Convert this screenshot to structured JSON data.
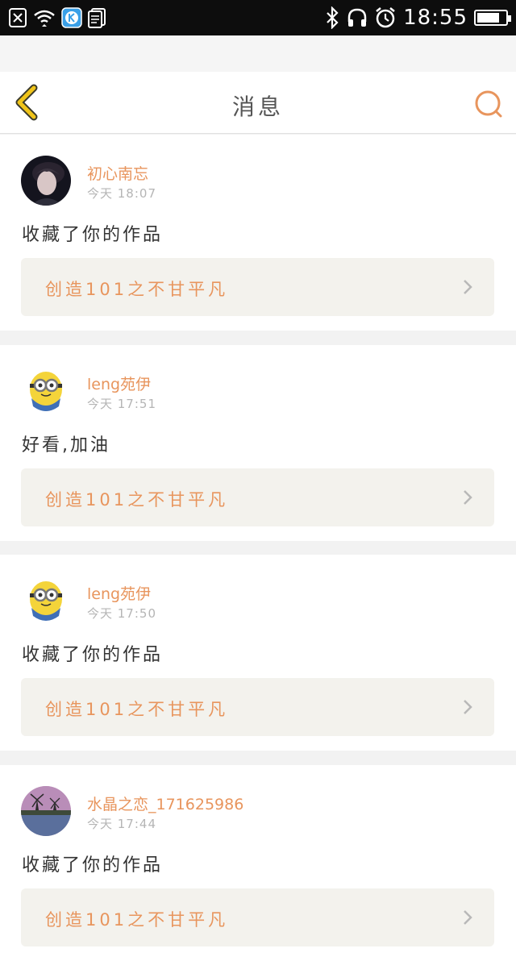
{
  "status_bar": {
    "time": "18:55",
    "battery_level": 0.8,
    "left_icons": [
      "sim-off-icon",
      "wifi-icon",
      "k-app-icon",
      "notes-icon"
    ],
    "right_icons": [
      "bluetooth-icon",
      "headphones-icon",
      "alarm-icon"
    ]
  },
  "header": {
    "title": "消息",
    "back_icon": "chevron-left-icon",
    "search_icon": "search-icon"
  },
  "colors": {
    "accent": "#e8955d",
    "back": "#f0c419",
    "link_bg": "#f3f2ed"
  },
  "messages": [
    {
      "username": "初心南忘",
      "time": "今天 18:07",
      "message": "收藏了你的作品",
      "work_title": "创造101之不甘平凡",
      "avatar": "portrait-avatar"
    },
    {
      "username": "leng苑伊",
      "time": "今天 17:51",
      "message": "好看,加油",
      "work_title": "创造101之不甘平凡",
      "avatar": "minion-avatar"
    },
    {
      "username": "leng苑伊",
      "time": "今天 17:50",
      "message": "收藏了你的作品",
      "work_title": "创造101之不甘平凡",
      "avatar": "minion-avatar"
    },
    {
      "username": "水晶之恋_171625986",
      "time": "今天 17:44",
      "message": "收藏了你的作品",
      "work_title": "创造101之不甘平凡",
      "avatar": "windmill-avatar"
    }
  ]
}
